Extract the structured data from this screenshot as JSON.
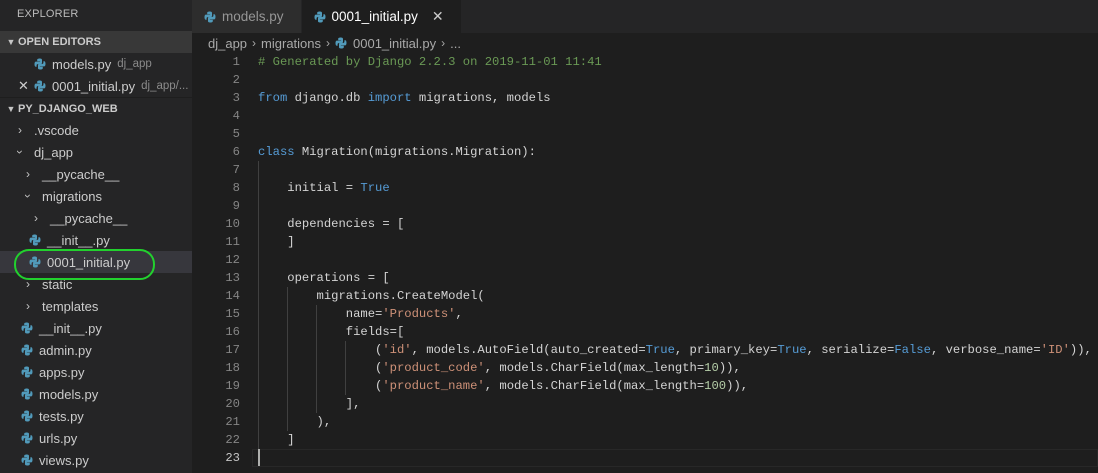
{
  "sidebar": {
    "title": "EXPLORER",
    "open_editors": {
      "header": "OPEN EDITORS",
      "items": [
        {
          "label": "models.py",
          "desc": "dj_app"
        },
        {
          "label": "0001_initial.py",
          "desc": "dj_app/..."
        }
      ]
    },
    "project": {
      "header": "PY_DJANGO_WEB",
      "tree": {
        "vscode": ".vscode",
        "dj_app": "dj_app",
        "pycache1": "__pycache__",
        "migrations": "migrations",
        "pycache2": "__pycache__",
        "init_mig": "__init__.py",
        "initial": "0001_initial.py",
        "static": "static",
        "templates": "templates",
        "init_app": "__init__.py",
        "admin": "admin.py",
        "apps": "apps.py",
        "models": "models.py",
        "tests": "tests.py",
        "urls": "urls.py",
        "views": "views.py"
      }
    }
  },
  "tabs": [
    {
      "label": "models.py"
    },
    {
      "label": "0001_initial.py"
    }
  ],
  "breadcrumb": [
    "dj_app",
    "migrations",
    "0001_initial.py",
    "..."
  ],
  "code": {
    "line_numbers": [
      "1",
      "2",
      "3",
      "4",
      "5",
      "6",
      "7",
      "8",
      "9",
      "10",
      "11",
      "12",
      "13",
      "14",
      "15",
      "16",
      "17",
      "18",
      "19",
      "20",
      "21",
      "22",
      "23"
    ],
    "l1": "# Generated by Django 2.2.3 on 2019-11-01 11:41",
    "l3": {
      "kw1": "from",
      "mod": " django.db ",
      "kw2": "import",
      "rest": " migrations, models"
    },
    "l6": {
      "kw": "class",
      "name": " Migration",
      "rest": "(migrations.Migration):"
    },
    "l8": {
      "pre": "    initial = ",
      "val": "True"
    },
    "l10": "    dependencies = [",
    "l11": "    ]",
    "l13": "    operations = [",
    "l14": "        migrations.CreateModel(",
    "l15": {
      "pre": "            name=",
      "str": "'Products'",
      "post": ","
    },
    "l16": "            fields=[",
    "l17": {
      "p1": "                (",
      "s1": "'id'",
      "p2": ", models.AutoField(auto_created=",
      "k1": "True",
      "p3": ", primary_key=",
      "k2": "True",
      "p4": ", serialize=",
      "k3": "False",
      "p5": ", verbose_name=",
      "s2": "'ID'",
      "p6": ")),"
    },
    "l18": {
      "p1": "                (",
      "s1": "'product_code'",
      "p2": ", models.CharField(max_length=",
      "n1": "10",
      "p3": ")),"
    },
    "l19": {
      "p1": "                (",
      "s1": "'product_name'",
      "p2": ", models.CharField(max_length=",
      "n1": "100",
      "p3": ")),"
    },
    "l20": "            ],",
    "l21": "        ),",
    "l22": "    ]"
  },
  "colors": {
    "highlight_circle": "#22d12e",
    "python_icon_blue": "#519aba"
  }
}
